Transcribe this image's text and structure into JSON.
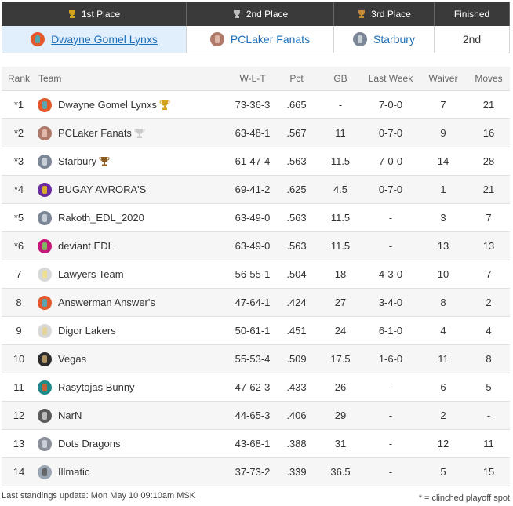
{
  "podium": {
    "headers": [
      "1st Place",
      "2nd Place",
      "3rd Place",
      "Finished"
    ],
    "first": {
      "team": "Dwayne Gomel Lynxs",
      "avatar_color": "#e25a2b"
    },
    "second": {
      "team": "PCLaker Fanats",
      "avatar_color": "#b07a6a"
    },
    "third": {
      "team": "Starbury",
      "avatar_color": "#7b8696"
    },
    "finished": "2nd"
  },
  "table": {
    "headers": {
      "rank": "Rank",
      "team": "Team",
      "wlt": "W-L-T",
      "pct": "Pct",
      "gb": "GB",
      "last_week": "Last Week",
      "waiver": "Waiver",
      "moves": "Moves"
    },
    "rows": [
      {
        "rank": "*1",
        "team": "Dwayne Gomel Lynxs",
        "wlt": "73-36-3",
        "pct": ".665",
        "gb": "-",
        "last_week": "7-0-0",
        "waiver": "7",
        "moves": "21",
        "avatar": "#e25a2b",
        "trophy": "gold"
      },
      {
        "rank": "*2",
        "team": "PCLaker Fanats",
        "wlt": "63-48-1",
        "pct": ".567",
        "gb": "11",
        "last_week": "0-7-0",
        "waiver": "9",
        "moves": "16",
        "avatar": "#b07a6a",
        "trophy": "silver"
      },
      {
        "rank": "*3",
        "team": "Starbury",
        "wlt": "61-47-4",
        "pct": ".563",
        "gb": "11.5",
        "last_week": "7-0-0",
        "waiver": "14",
        "moves": "28",
        "avatar": "#7b8696",
        "trophy": "bronze"
      },
      {
        "rank": "*4",
        "team": "BUGAY AVRORA'S",
        "wlt": "69-41-2",
        "pct": ".625",
        "gb": "4.5",
        "last_week": "0-7-0",
        "waiver": "1",
        "moves": "21",
        "avatar": "#6a2ca0",
        "trophy": ""
      },
      {
        "rank": "*5",
        "team": "Rakoth_EDL_2020",
        "wlt": "63-49-0",
        "pct": ".563",
        "gb": "11.5",
        "last_week": "-",
        "waiver": "3",
        "moves": "7",
        "avatar": "#7b8696",
        "trophy": ""
      },
      {
        "rank": "*6",
        "team": "deviant EDL",
        "wlt": "63-49-0",
        "pct": ".563",
        "gb": "11.5",
        "last_week": "-",
        "waiver": "13",
        "moves": "13",
        "avatar": "#c2187a",
        "trophy": ""
      },
      {
        "rank": "7",
        "team": "Lawyers Team",
        "wlt": "56-55-1",
        "pct": ".504",
        "gb": "18",
        "last_week": "4-3-0",
        "waiver": "10",
        "moves": "7",
        "avatar": "#d8d8d8",
        "trophy": ""
      },
      {
        "rank": "8",
        "team": "Answerman Answer's",
        "wlt": "47-64-1",
        "pct": ".424",
        "gb": "27",
        "last_week": "3-4-0",
        "waiver": "8",
        "moves": "2",
        "avatar": "#e25a2b",
        "trophy": ""
      },
      {
        "rank": "9",
        "team": "Digor Lakers",
        "wlt": "50-61-1",
        "pct": ".451",
        "gb": "24",
        "last_week": "6-1-0",
        "waiver": "4",
        "moves": "4",
        "avatar": "#d8d8d8",
        "trophy": ""
      },
      {
        "rank": "10",
        "team": "Vegas",
        "wlt": "55-53-4",
        "pct": ".509",
        "gb": "17.5",
        "last_week": "1-6-0",
        "waiver": "11",
        "moves": "8",
        "avatar": "#2b2b2b",
        "trophy": ""
      },
      {
        "rank": "11",
        "team": "Rasytojas Bunny",
        "wlt": "47-62-3",
        "pct": ".433",
        "gb": "26",
        "last_week": "-",
        "waiver": "6",
        "moves": "5",
        "avatar": "#1e8a8a",
        "trophy": ""
      },
      {
        "rank": "12",
        "team": "NarN",
        "wlt": "44-65-3",
        "pct": ".406",
        "gb": "29",
        "last_week": "-",
        "waiver": "2",
        "moves": "-",
        "avatar": "#5a5a5a",
        "trophy": ""
      },
      {
        "rank": "13",
        "team": "Dots Dragons",
        "wlt": "43-68-1",
        "pct": ".388",
        "gb": "31",
        "last_week": "-",
        "waiver": "12",
        "moves": "11",
        "avatar": "#8a8f99",
        "trophy": ""
      },
      {
        "rank": "14",
        "team": "Illmatic",
        "wlt": "37-73-2",
        "pct": ".339",
        "gb": "36.5",
        "last_week": "-",
        "waiver": "5",
        "moves": "15",
        "avatar": "#9aa6b4",
        "trophy": ""
      }
    ]
  },
  "footer": {
    "last_update": "Last standings update: Mon May 10 09:10am MSK",
    "legend": "* = clinched playoff spot"
  },
  "colors": {
    "header_bg": "#3a3a3a",
    "highlight": "#e1eefb",
    "link": "#1d6fb8",
    "gold": "#d4a51c",
    "silver": "#bdbdbd",
    "bronze": "#8a5a1e"
  }
}
